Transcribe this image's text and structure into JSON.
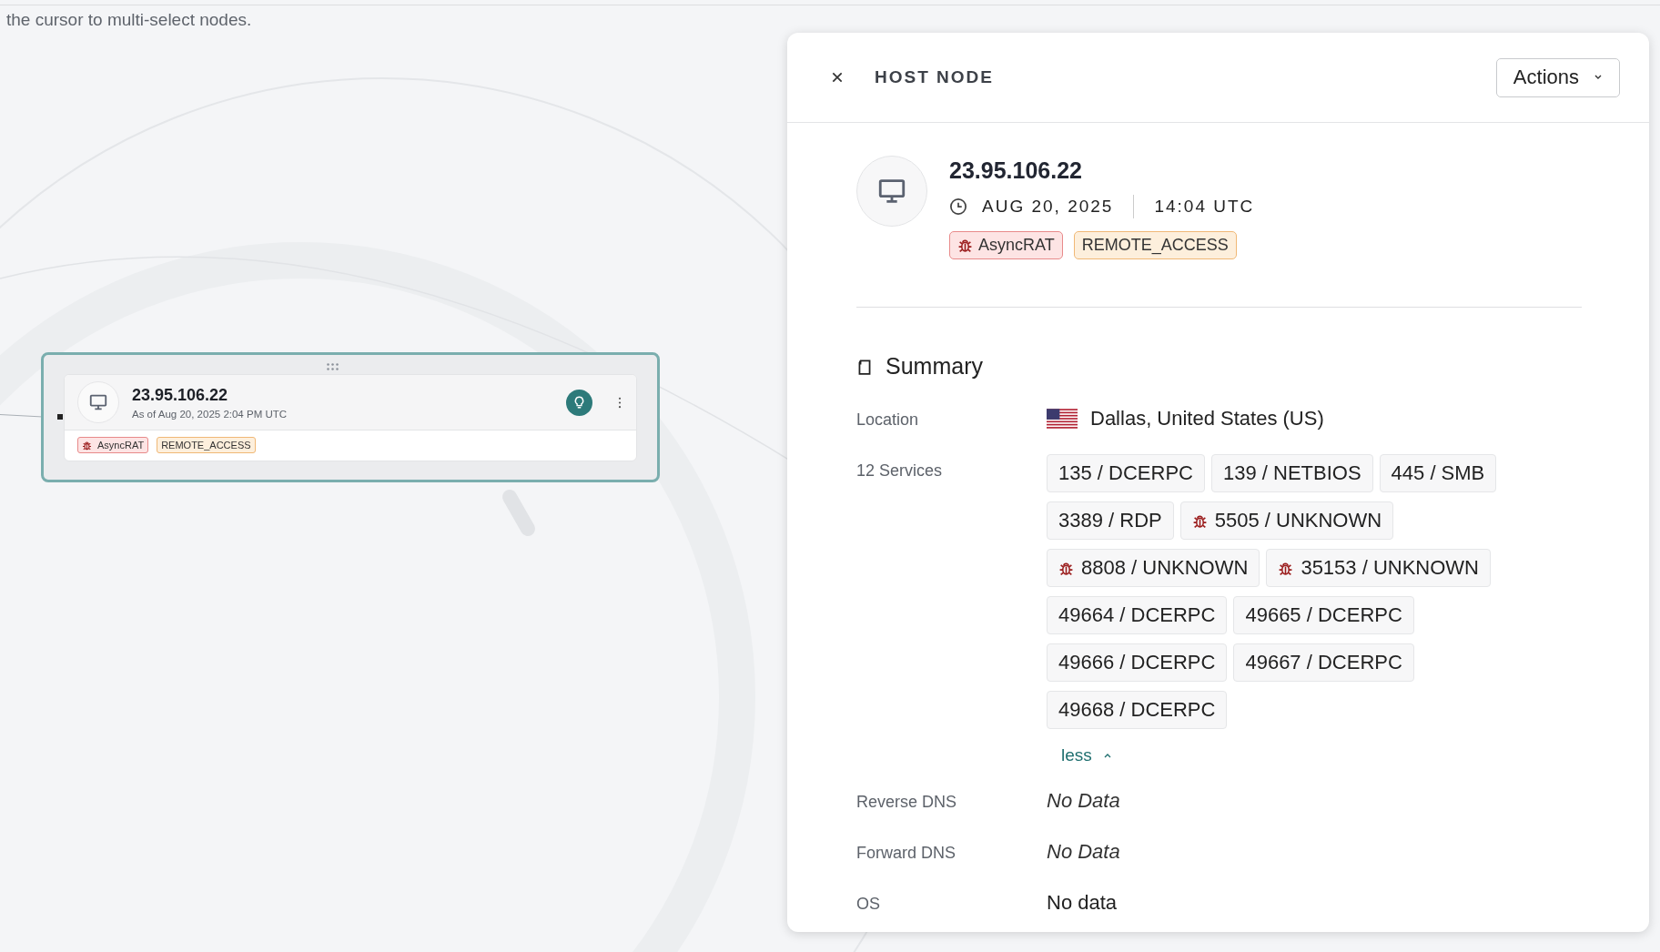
{
  "canvas": {
    "hint": "the cursor to multi-select nodes."
  },
  "node": {
    "title": "23.95.106.22",
    "subtitle": "As of Aug 20, 2025 2:04 PM UTC",
    "selected": true,
    "tags": [
      {
        "label": "AsyncRAT",
        "kind": "malware"
      },
      {
        "label": "REMOTE_ACCESS",
        "kind": "category"
      }
    ]
  },
  "panel": {
    "title": "HOST NODE",
    "actions": "Actions",
    "ip": "23.95.106.22",
    "date": "AUG 20, 2025",
    "time": "14:04 UTC",
    "tags": [
      {
        "label": "AsyncRAT",
        "kind": "malware"
      },
      {
        "label": "REMOTE_ACCESS",
        "kind": "category"
      }
    ],
    "summary": {
      "title": "Summary",
      "location_label": "Location",
      "location": "Dallas, United States (US)",
      "services_label": "12 Services",
      "services": [
        {
          "label": "135 / DCERPC",
          "flagged": false
        },
        {
          "label": "139 / NETBIOS",
          "flagged": false
        },
        {
          "label": "445 / SMB",
          "flagged": false
        },
        {
          "label": "3389 / RDP",
          "flagged": false
        },
        {
          "label": "5505 / UNKNOWN",
          "flagged": true
        },
        {
          "label": "8808 / UNKNOWN",
          "flagged": true
        },
        {
          "label": "35153 / UNKNOWN",
          "flagged": true
        },
        {
          "label": "49664 / DCERPC",
          "flagged": false
        },
        {
          "label": "49665 / DCERPC",
          "flagged": false
        },
        {
          "label": "49666 / DCERPC",
          "flagged": false
        },
        {
          "label": "49667 / DCERPC",
          "flagged": false
        },
        {
          "label": "49668 / DCERPC",
          "flagged": false
        }
      ],
      "toggle": "less",
      "expanded": true,
      "fields": [
        {
          "label": "Reverse DNS",
          "value": "No Data",
          "kind": "empty"
        },
        {
          "label": "Forward DNS",
          "value": "No Data",
          "kind": "empty"
        },
        {
          "label": "OS",
          "value": "No data",
          "kind": "plain"
        }
      ]
    }
  }
}
